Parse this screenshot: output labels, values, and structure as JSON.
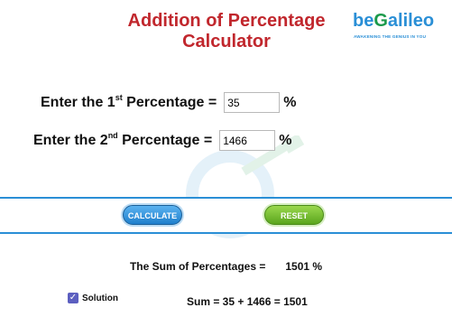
{
  "header": {
    "title_line1": "Addition of Percentage",
    "title_line2": "Calculator"
  },
  "logo": {
    "brand_be": "be",
    "brand_g": "G",
    "brand_rest": "alileo",
    "tagline": "AWAKENING THE GENIUS IN YOU"
  },
  "form": {
    "first": {
      "label_pre": "Enter the 1",
      "label_sup": "st",
      "label_post": " Percentage =",
      "value": "35",
      "unit": "%"
    },
    "second": {
      "label_pre": "Enter the 2",
      "label_sup": "nd",
      "label_post": " Percentage =",
      "value": "1466",
      "unit": "%"
    }
  },
  "buttons": {
    "calculate": "CALCULATE",
    "reset": "RESET"
  },
  "result": {
    "label": "The Sum of Percentages =",
    "value": "1501 %"
  },
  "solution": {
    "checked": true,
    "label": "Solution",
    "equation": "Sum = 35 + 1466 = 1501"
  },
  "colors": {
    "title": "#c1272d",
    "brand_blue": "#2a8fd6",
    "brand_green": "#1b9a4b",
    "calculate_button": "#2a8fd6",
    "reset_button": "#6cb52a",
    "checkbox": "#5c5fc0"
  }
}
